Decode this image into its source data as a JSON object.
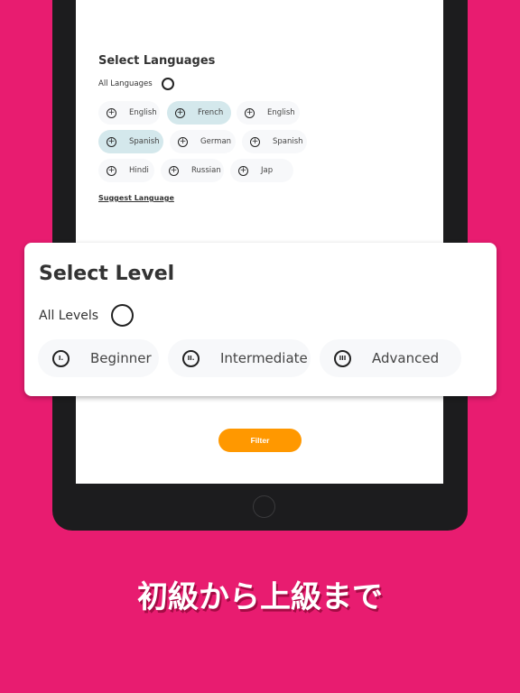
{
  "languages": {
    "title": "Select Languages",
    "all_label": "All Languages",
    "suggest": "Suggest Language",
    "items": [
      {
        "label": "English",
        "selected": false
      },
      {
        "label": "French",
        "selected": true
      },
      {
        "label": "English",
        "selected": false
      },
      {
        "label": "Spanish",
        "selected": true
      },
      {
        "label": "German",
        "selected": false
      },
      {
        "label": "Spanish",
        "selected": false
      },
      {
        "label": "Hindi",
        "selected": false
      },
      {
        "label": "Russian",
        "selected": false
      },
      {
        "label": "Jap",
        "selected": false
      }
    ]
  },
  "levels": {
    "title": "Select Level",
    "all_label": "All Levels",
    "items": [
      {
        "label": "Beginner",
        "icon": "I."
      },
      {
        "label": "Intermediate",
        "icon": "II."
      },
      {
        "label": "Advanced",
        "icon": "III"
      }
    ]
  },
  "filter_label": "Filter",
  "caption": "初級から上級まで",
  "colors": {
    "background": "#e81c70",
    "accent": "#ff9800",
    "selected_chip": "#d4e8ec"
  }
}
